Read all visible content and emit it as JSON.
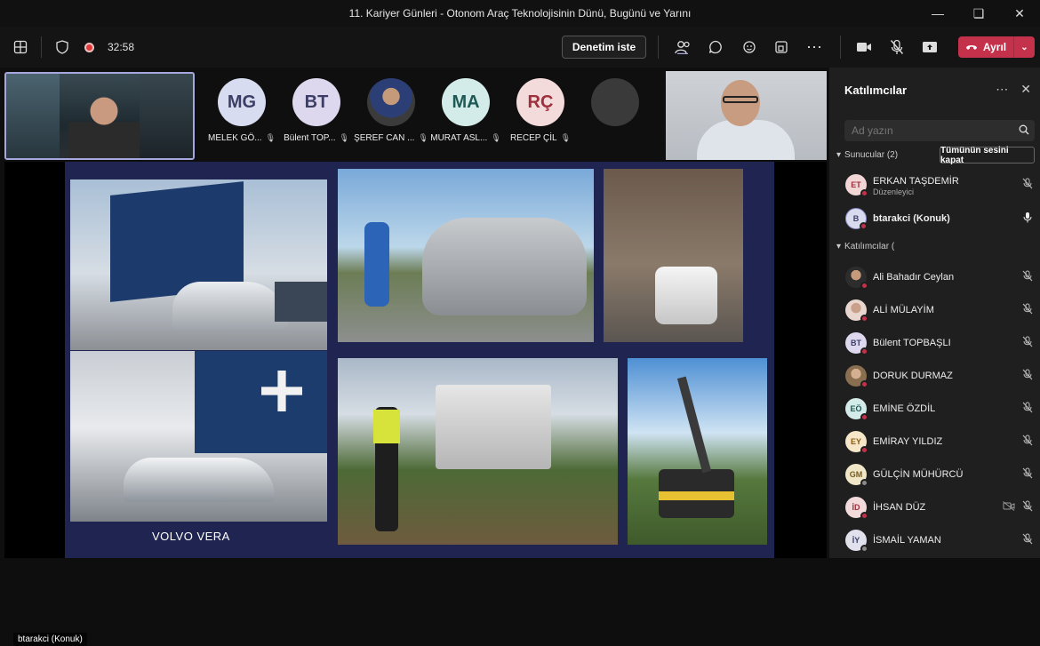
{
  "window": {
    "title": "11. Kariyer Günleri - Otonom Araç Teknolojisinin Dünü, Bugünü ve Yarını",
    "controls": [
      "minimize-icon",
      "maximize-icon",
      "close-icon"
    ]
  },
  "toolbar": {
    "timer": "32:58",
    "ask_control_label": "Denetim iste",
    "leave_label": "Ayrıl"
  },
  "stage": {
    "self_name": "btarakci (Konuk)",
    "tiles": [
      {
        "initials": "MG",
        "name": "MELEK GÖ...",
        "color": "#d7dcf0"
      },
      {
        "initials": "BT",
        "name": "Bülent TOP...",
        "color": "#ddd8ee"
      },
      {
        "initials": "",
        "name": "ŞEREF CAN ...",
        "color": "#3b3b3b"
      },
      {
        "initials": "MA",
        "name": "MURAT ASL...",
        "color": "#d4ece9"
      },
      {
        "initials": "RÇ",
        "name": "RECEP ÇİL",
        "color": "#f3dadb"
      },
      {
        "initials": "",
        "name": "",
        "color": "#3a3a3a"
      }
    ],
    "slide_caption": "VOLVO VERA"
  },
  "panel": {
    "title": "Katılımcılar",
    "search_placeholder": "Ad yazın",
    "presenters_label": "Sunucular (2)",
    "mute_all_label": "Tümünün sesini kapat",
    "attendees_label": "Katılımcılar (",
    "presenters": [
      {
        "initials": "ET",
        "name": "ERKAN TAŞDEMİR",
        "role": "Düzenleyici",
        "color": "#f2d6d6",
        "mic": "off"
      },
      {
        "initials": "B",
        "name": "btarakci (Konuk)",
        "role": "",
        "color": "#d8dbee",
        "mic": "on"
      }
    ],
    "attendees": [
      {
        "initials": "",
        "name": "Ali Bahadır Ceylan",
        "color": "#5a4a3a",
        "status": "red"
      },
      {
        "initials": "",
        "name": "ALİ MÜLAYİM",
        "color": "#e9d7cf",
        "status": "red"
      },
      {
        "initials": "BT",
        "name": "Bülent TOPBAŞLI",
        "color": "#ddd8ee",
        "status": "red"
      },
      {
        "initials": "",
        "name": "DORUK DURMAZ",
        "color": "#b28a65",
        "status": "red"
      },
      {
        "initials": "EÖ",
        "name": "EMİNE ÖZDİL",
        "color": "#d4ece9",
        "status": "red"
      },
      {
        "initials": "EY",
        "name": "EMİRAY YILDIZ",
        "color": "#f6e7c9",
        "status": "red"
      },
      {
        "initials": "GM",
        "name": "GÜLÇİN MÜHÜRCÜ",
        "color": "#f0e6c8",
        "status": "grey"
      },
      {
        "initials": "İD",
        "name": "İHSAN DÜZ",
        "color": "#f3dadb",
        "status": "red",
        "camera": true
      },
      {
        "initials": "İY",
        "name": "İSMAİL YAMAN",
        "color": "#e1e1ee",
        "status": "grey"
      }
    ]
  }
}
